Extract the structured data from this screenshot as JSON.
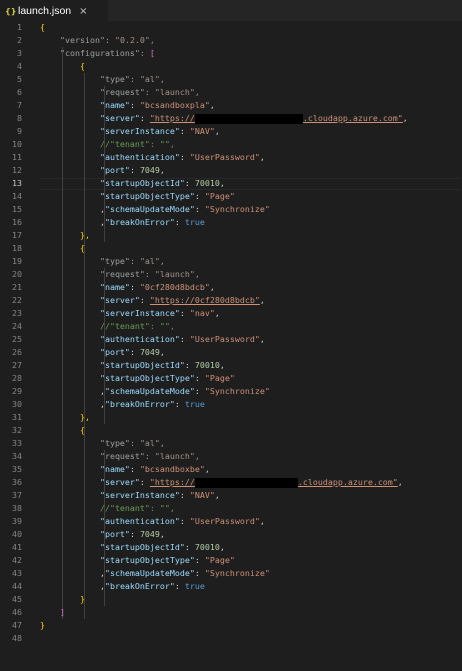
{
  "tab": {
    "icon": "{}",
    "title": "launch.json",
    "close": "×",
    "icon_name": "json-file-icon"
  },
  "editor": {
    "active_line": 13,
    "line_numbers": [
      "1",
      "2",
      "3",
      "4",
      "5",
      "6",
      "7",
      "8",
      "9",
      "10",
      "11",
      "12",
      "13",
      "14",
      "15",
      "16",
      "17",
      "18",
      "19",
      "20",
      "21",
      "22",
      "23",
      "24",
      "25",
      "26",
      "27",
      "28",
      "29",
      "30",
      "31",
      "32",
      "33",
      "34",
      "35",
      "36",
      "37",
      "38",
      "39",
      "40",
      "41",
      "42",
      "43",
      "44",
      "45",
      "46",
      "47",
      "48"
    ],
    "root_open": "{",
    "root_close": "}",
    "version_key": "\"version\"",
    "version_value": "\"0.2.0\"",
    "configurations_key": "\"configurations\"",
    "array_open": "[",
    "array_close": "]",
    "configs": [
      {
        "type_key": "\"type\"",
        "type_value": "\"al\"",
        "request_key": "\"request\"",
        "request_value": "\"launch\"",
        "name_key": "\"name\"",
        "name_value": "\"bcsandboxpla\"",
        "server_key": "\"server\"",
        "server_prefix": "\"https://",
        "server_suffix": ".cloudapp.azure.com\"",
        "serverInstance_key": "\"serverInstance\"",
        "serverInstance_value": "\"NAV\"",
        "tenant_comment": "//\"tenant\": \"\",",
        "authentication_key": "\"authentication\"",
        "authentication_value": "\"UserPassword\"",
        "port_key": "\"port\"",
        "port_value": "7049",
        "startupObjectId_key": "\"startupObjectId\"",
        "startupObjectId_value": "70010",
        "startupObjectType_key": "\"startupObjectType\"",
        "startupObjectType_value": "\"Page\"",
        "schemaUpdateMode_key": "\"schemaUpdateMode\"",
        "schemaUpdateMode_value": "\"Synchronize\"",
        "breakOnError_key": "\"breakOnError\"",
        "breakOnError_value": "true",
        "close": "},"
      },
      {
        "type_key": "\"type\"",
        "type_value": "\"al\"",
        "request_key": "\"request\"",
        "request_value": "\"launch\"",
        "name_key": "\"name\"",
        "name_value": "\"0cf280d8bdcb\"",
        "server_key": "\"server\"",
        "server_value": "\"https://0cf280d8bdcb\"",
        "serverInstance_key": "\"serverInstance\"",
        "serverInstance_value": "\"nav\"",
        "tenant_comment": "//\"tenant\": \"\",",
        "authentication_key": "\"authentication\"",
        "authentication_value": "\"UserPassword\"",
        "port_key": "\"port\"",
        "port_value": "7049",
        "startupObjectId_key": "\"startupObjectId\"",
        "startupObjectId_value": "70010",
        "startupObjectType_key": "\"startupObjectType\"",
        "startupObjectType_value": "\"Page\"",
        "schemaUpdateMode_key": "\"schemaUpdateMode\"",
        "schemaUpdateMode_value": "\"Synchronize\"",
        "breakOnError_key": "\"breakOnError\"",
        "breakOnError_value": "true",
        "close": "},"
      },
      {
        "type_key": "\"type\"",
        "type_value": "\"al\"",
        "request_key": "\"request\"",
        "request_value": "\"launch\"",
        "name_key": "\"name\"",
        "name_value": "\"bcsandboxbe\"",
        "server_key": "\"server\"",
        "server_prefix": "\"https://",
        "server_suffix": ".cloudapp.azure.com\"",
        "serverInstance_key": "\"serverInstance\"",
        "serverInstance_value": "\"NAV\"",
        "tenant_comment": "//\"tenant\": \"\",",
        "authentication_key": "\"authentication\"",
        "authentication_value": "\"UserPassword\"",
        "port_key": "\"port\"",
        "port_value": "7049",
        "startupObjectId_key": "\"startupObjectId\"",
        "startupObjectId_value": "70010",
        "startupObjectType_key": "\"startupObjectType\"",
        "startupObjectType_value": "\"Page\"",
        "schemaUpdateMode_key": "\"schemaUpdateMode\"",
        "schemaUpdateMode_value": "\"Synchronize\"",
        "breakOnError_key": "\"breakOnError\"",
        "breakOnError_value": "true",
        "close": "}"
      }
    ]
  },
  "colors": {
    "background": "#1e1e1e",
    "key": "#9cdcfe",
    "string": "#ce9178",
    "number": "#b5cea8",
    "keyword": "#569cd6",
    "comment": "#6a9955",
    "line_number": "#858585"
  }
}
